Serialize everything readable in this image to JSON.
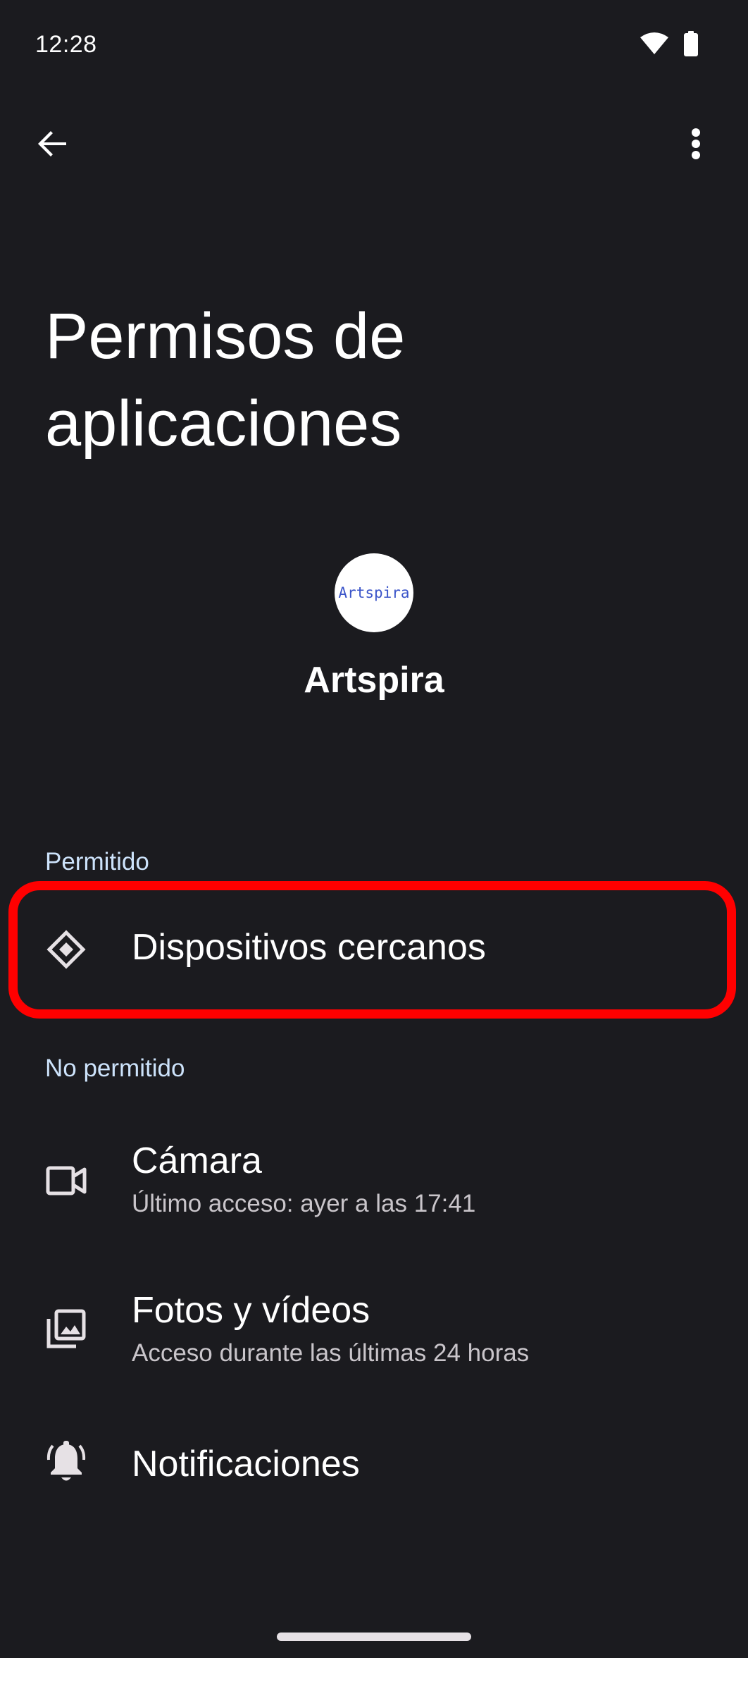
{
  "status_bar": {
    "time": "12:28",
    "wifi_icon": "wifi-icon",
    "battery_icon": "battery-icon"
  },
  "app_bar": {
    "back_icon": "arrow-left-icon",
    "more_icon": "more-vertical-icon"
  },
  "page": {
    "title_line1": "Permisos de",
    "title_line2": "aplicaciones"
  },
  "app": {
    "icon_text": "Artspira",
    "name": "Artspira"
  },
  "sections": {
    "allowed_label": "Permitido",
    "not_allowed_label": "No permitido"
  },
  "permissions": {
    "nearby": {
      "title": "Dispositivos cercanos",
      "icon": "nearby-devices-icon"
    },
    "camera": {
      "title": "Cámara",
      "subtitle": "Último acceso: ayer a las 17:41",
      "icon": "camera-icon"
    },
    "photos": {
      "title": "Fotos y vídeos",
      "subtitle": "Acceso durante las últimas 24 horas",
      "icon": "photos-icon"
    },
    "notifications": {
      "title": "Notificaciones",
      "icon": "bell-icon"
    }
  },
  "colors": {
    "background": "#1b1b1f",
    "section_label": "#cde3fb",
    "highlight": "#ff0000"
  }
}
